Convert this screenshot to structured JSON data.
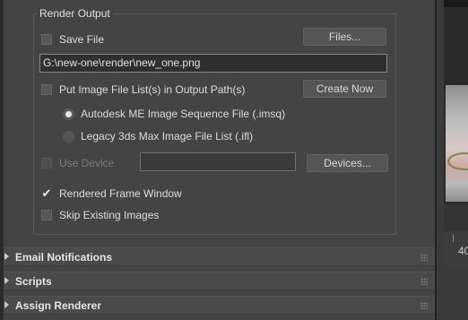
{
  "render_output": {
    "group_title": "Render Output",
    "save_file": {
      "label": "Save File",
      "checked": false
    },
    "files_button": "Files...",
    "output_path": "G:\\new-one\\render\\new_one.png",
    "put_image_list": {
      "label": "Put Image File List(s) in Output Path(s)",
      "checked": false
    },
    "create_now_button": "Create Now",
    "radio_imsq": {
      "label": "Autodesk ME Image Sequence File (.imsq)",
      "selected": true
    },
    "radio_ifl": {
      "label": "Legacy 3ds Max Image File List (.ifl)",
      "selected": false
    },
    "use_device": {
      "label": "Use Device",
      "checked": false,
      "disabled": true
    },
    "device_field": "",
    "devices_button": "Devices...",
    "rendered_frame_window": {
      "label": "Rendered Frame Window",
      "checked": true
    },
    "skip_existing": {
      "label": "Skip Existing Images",
      "checked": false
    }
  },
  "rollouts": [
    {
      "title": "Email Notifications"
    },
    {
      "title": "Scripts"
    },
    {
      "title": "Assign Renderer"
    }
  ],
  "viewport": {
    "timeline_number": "40"
  }
}
